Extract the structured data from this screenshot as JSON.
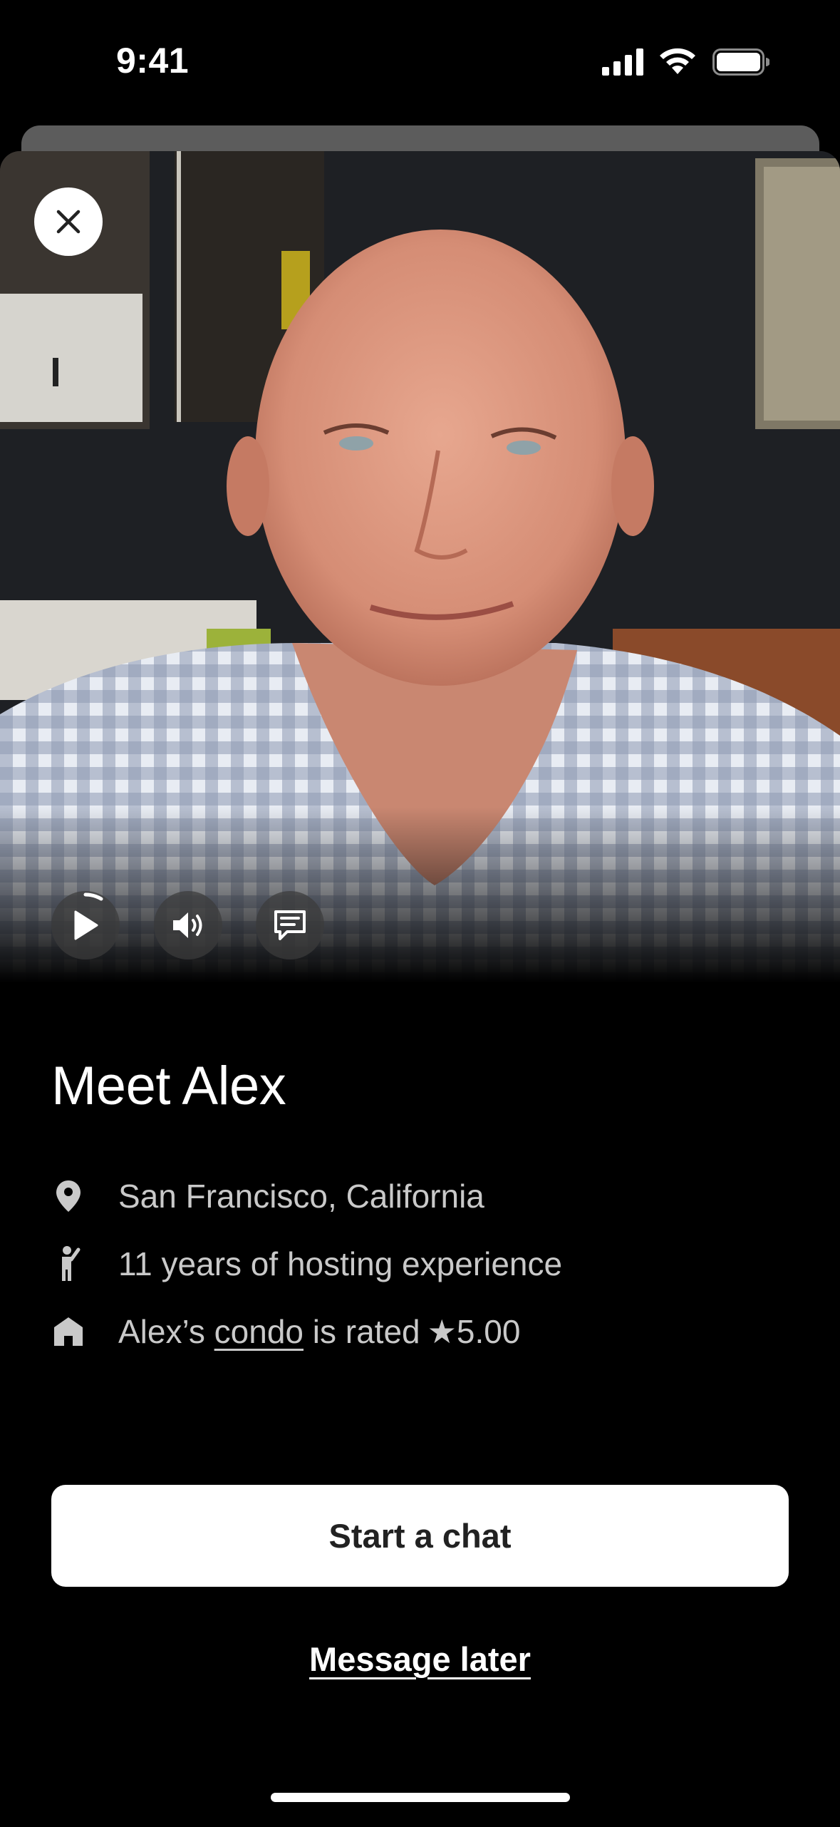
{
  "status_bar": {
    "time": "9:41"
  },
  "host": {
    "title": "Meet Alex",
    "location": "San Francisco, California",
    "experience": "11 years of hosting experience",
    "rating_prefix": "Alex’s",
    "rating_link": "condo",
    "rating_middle": "is rated",
    "rating_value": "★5.00"
  },
  "actions": {
    "primary_label": "Start a chat",
    "secondary_label": "Message later"
  },
  "icons": {
    "close": "close-icon",
    "play": "play-icon",
    "sound": "speaker-icon",
    "captions": "captions-icon",
    "location": "location-pin-icon",
    "experience": "person-waving-icon",
    "home": "home-icon"
  }
}
